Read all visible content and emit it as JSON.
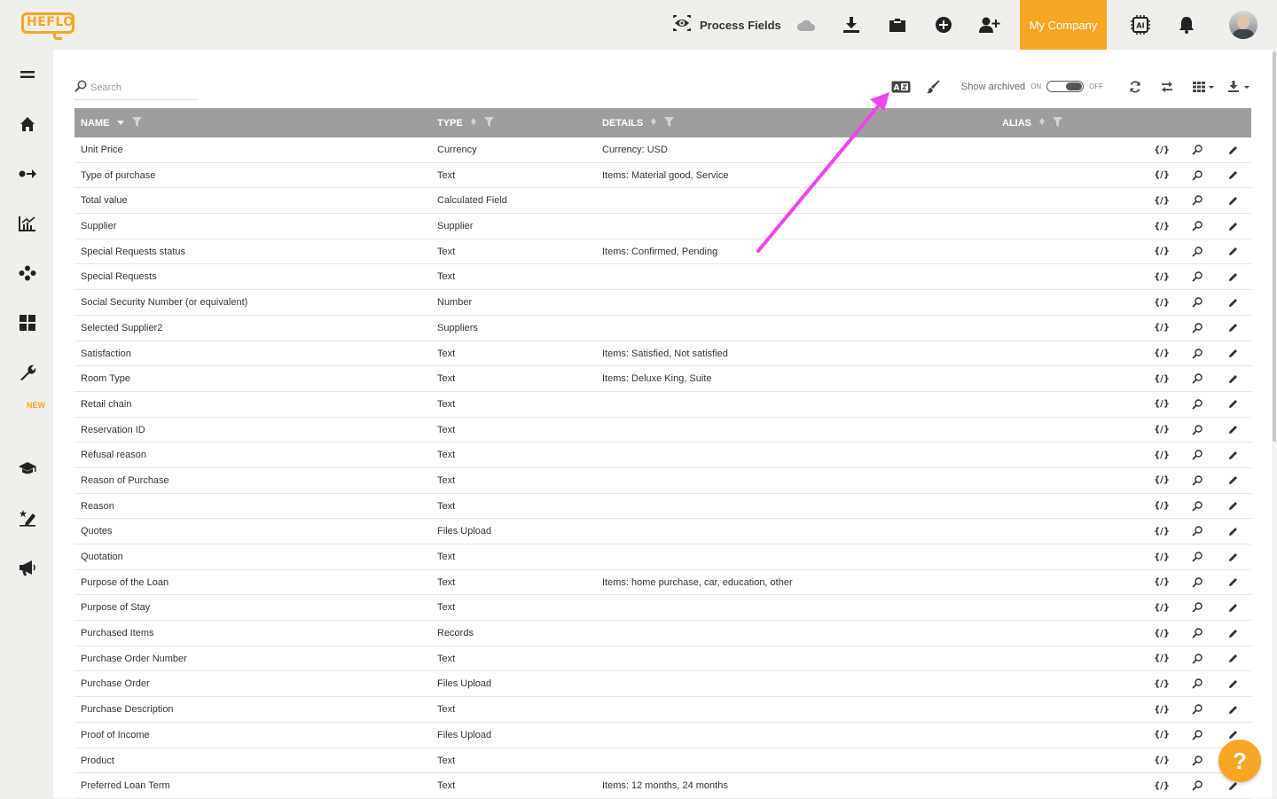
{
  "app": {
    "logo_text": "HEFLO"
  },
  "topbar": {
    "page_title": "Process Fields",
    "company": "My Company",
    "icons": [
      "eye-icon",
      "cloud-icon",
      "download-icon",
      "folder-icon",
      "add-circle-icon",
      "add-user-icon",
      "ai-chip-icon",
      "bell-icon"
    ]
  },
  "sidebar": {
    "items": [
      "menu-icon",
      "home-icon",
      "flow-icon",
      "chart-icon",
      "cluster-icon",
      "dashboard-icon",
      "wrench-icon",
      "graduation-icon",
      "sign-icon",
      "megaphone-icon"
    ],
    "new_badge": "NEW"
  },
  "toolbar": {
    "search_placeholder": "Search",
    "show_archived_label": "Show archived",
    "toggle_on": "ON",
    "toggle_off": "OFF"
  },
  "table": {
    "columns": {
      "name": "NAME",
      "type": "TYPE",
      "details": "DETAILS",
      "alias": "ALIAS"
    },
    "rows": [
      {
        "name": "Unit Price",
        "type": "Currency",
        "details": "Currency: USD"
      },
      {
        "name": "Type of purchase",
        "type": "Text",
        "details": "Items: Material good, Service"
      },
      {
        "name": "Total value",
        "type": "Calculated Field",
        "details": ""
      },
      {
        "name": "Supplier",
        "type": "Supplier",
        "details": ""
      },
      {
        "name": "Special Requests status",
        "type": "Text",
        "details": "Items: Confirmed, Pending"
      },
      {
        "name": "Special Requests",
        "type": "Text",
        "details": ""
      },
      {
        "name": "Social Security Number (or equivalent)",
        "type": "Number",
        "details": ""
      },
      {
        "name": "Selected Supplier2",
        "type": "Suppliers",
        "details": ""
      },
      {
        "name": "Satisfaction",
        "type": "Text",
        "details": "Items: Satisfied, Not satisfied"
      },
      {
        "name": "Room Type",
        "type": "Text",
        "details": "Items: Deluxe King, Suite"
      },
      {
        "name": "Retail chain",
        "type": "Text",
        "details": ""
      },
      {
        "name": "Reservation ID",
        "type": "Text",
        "details": ""
      },
      {
        "name": "Refusal reason",
        "type": "Text",
        "details": ""
      },
      {
        "name": "Reason of Purchase",
        "type": "Text",
        "details": ""
      },
      {
        "name": "Reason",
        "type": "Text",
        "details": ""
      },
      {
        "name": "Quotes",
        "type": "Files Upload",
        "details": ""
      },
      {
        "name": "Quotation",
        "type": "Text",
        "details": ""
      },
      {
        "name": "Purpose of the Loan",
        "type": "Text",
        "details": "Items: home purchase, car, education, other"
      },
      {
        "name": "Purpose of Stay",
        "type": "Text",
        "details": ""
      },
      {
        "name": "Purchased Items",
        "type": "Records",
        "details": ""
      },
      {
        "name": "Purchase Order Number",
        "type": "Text",
        "details": ""
      },
      {
        "name": "Purchase Order",
        "type": "Files Upload",
        "details": ""
      },
      {
        "name": "Purchase Description",
        "type": "Text",
        "details": ""
      },
      {
        "name": "Proof of Income",
        "type": "Files Upload",
        "details": ""
      },
      {
        "name": "Product",
        "type": "Text",
        "details": ""
      },
      {
        "name": "Preferred Loan Term",
        "type": "Text",
        "details": "Items: 12 months, 24 months"
      }
    ],
    "row_action_var_label": "{/}"
  },
  "help": {
    "label": "?"
  },
  "colors": {
    "accent": "#f5a623",
    "header_bg": "#9e9e9e",
    "annotation": "#ee44ee"
  }
}
